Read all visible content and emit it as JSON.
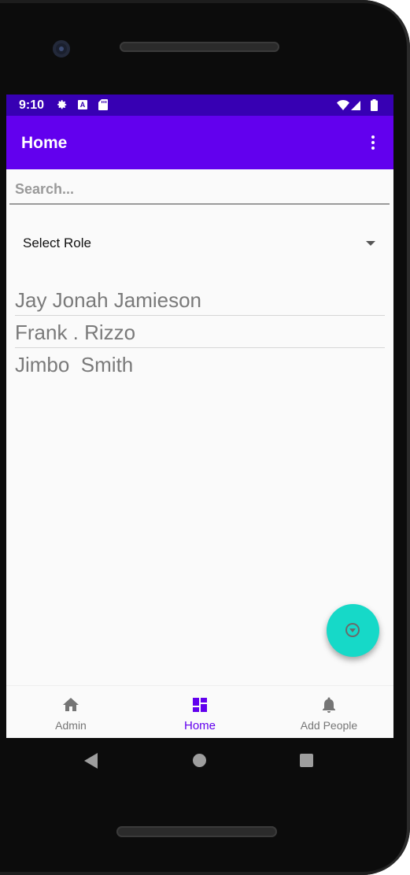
{
  "status_bar": {
    "time": "9:10",
    "icons": [
      "gear-icon",
      "a-icon",
      "sd-card-icon",
      "wifi-icon",
      "signal-icon",
      "battery-icon"
    ]
  },
  "app_bar": {
    "title": "Home",
    "menu_icon": "more-vert-icon"
  },
  "search": {
    "placeholder": "Search...",
    "value": ""
  },
  "role_select": {
    "selected": "Select Role"
  },
  "people": [
    "Jay Jonah Jamieson",
    "Frank . Rizzo",
    "Jimbo  Smith"
  ],
  "fab": {
    "icon": "arrow-drop-down-circle-icon",
    "color": "#16d9c8"
  },
  "bottom_nav": {
    "items": [
      {
        "label": "Admin",
        "icon": "home-icon"
      },
      {
        "label": "Home",
        "icon": "dashboard-icon",
        "active": true
      },
      {
        "label": "Add People",
        "icon": "bell-icon"
      }
    ]
  },
  "system_nav": {
    "buttons": [
      "back-button",
      "home-button",
      "recents-button"
    ]
  },
  "colors": {
    "status_bar": "#3700b3",
    "app_bar": "#6200ee",
    "accent": "#6200ee"
  }
}
